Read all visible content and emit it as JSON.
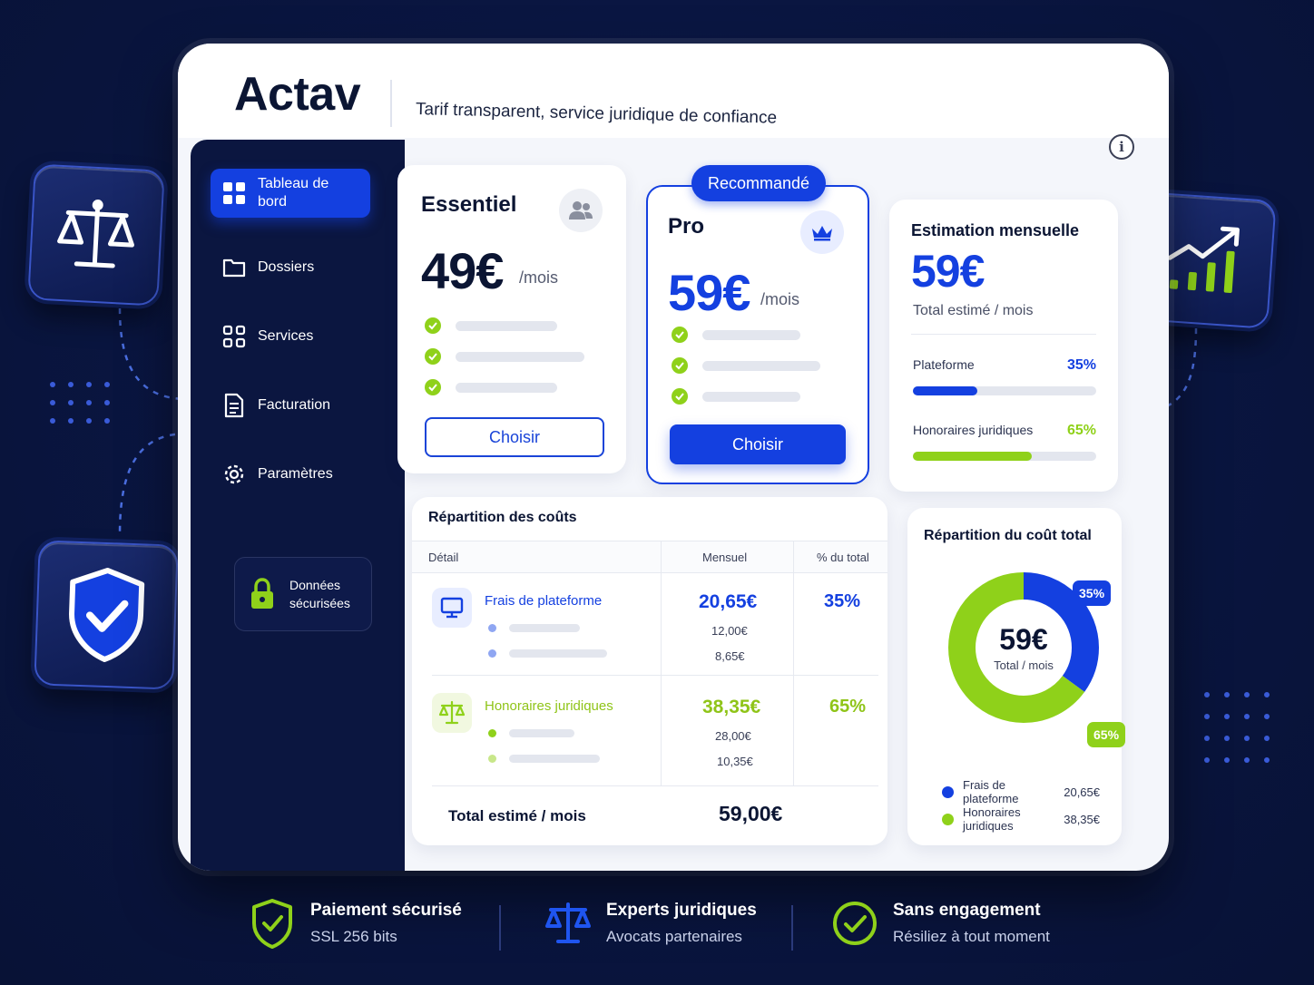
{
  "app": {
    "name": "Actav",
    "tagline": "Tarif transparent, service juridique de confiance"
  },
  "colors": {
    "brand_blue": "#1440e0",
    "accent_green": "#8fd11a",
    "sidebar_bg": "#0b1640",
    "page_bg": "#0a1642"
  },
  "sidebar": {
    "items": [
      {
        "label": "Tableau de bord",
        "icon": "dashboard-icon",
        "active": true
      },
      {
        "label": "Dossiers",
        "icon": "folder-icon",
        "active": false
      },
      {
        "label": "Services",
        "icon": "grid-icon",
        "active": false
      },
      {
        "label": "Facturation",
        "icon": "document-icon",
        "active": false
      },
      {
        "label": "Paramètres",
        "icon": "gear-icon",
        "active": false
      }
    ],
    "secure_label": "Données sécurisées"
  },
  "plans": [
    {
      "name": "Essentiel",
      "price": "49€",
      "unit": "/mois",
      "button": "Choisir",
      "icon": "users-icon",
      "features_count": 3
    },
    {
      "name": "Pro",
      "price": "59€",
      "unit": "/mois",
      "button": "Choisir",
      "icon": "crown-icon",
      "badge": "Recommandé",
      "features_count": 3
    }
  ],
  "estimate": {
    "title": "Estimation mensuelle",
    "amount": "59€",
    "subtitle": "Total estimé / mois",
    "rows": [
      {
        "label": "Plateforme",
        "pct": "35%",
        "value": 0.35,
        "color": "#1440e0"
      },
      {
        "label": "Honoraires juridiques",
        "pct": "65%",
        "value": 0.65,
        "color": "#8fd11a"
      }
    ]
  },
  "breakdown": {
    "title": "Répartition des coûts",
    "headers": {
      "detail": "Détail",
      "monthly": "Mensuel",
      "share": "% du total"
    },
    "rows": [
      {
        "name": "Frais de plateforme",
        "icon": "monitor-icon",
        "amount": "20,65€",
        "sub_amounts": [
          "12,00€",
          "8,65€"
        ],
        "share": "35%",
        "color": "#1440e0"
      },
      {
        "name": "Honoraires juridiques",
        "icon": "scale-icon",
        "amount": "38,35€",
        "sub_amounts": [
          "28,00€",
          "10,35€"
        ],
        "share": "65%",
        "color": "#8fd11a"
      }
    ],
    "total_label": "Total estimé / mois",
    "total_value": "59,00€"
  },
  "chart_data": {
    "type": "pie",
    "title": "Répartition du coût total",
    "center_value": "59€",
    "center_label": "Total / mois",
    "categories": [
      "Frais de plateforme",
      "Honoraires juridiques"
    ],
    "values": [
      35,
      65
    ],
    "value_labels": [
      "35%",
      "65%"
    ],
    "amounts": [
      "20,65€",
      "38,35€"
    ],
    "colors": [
      "#1440e0",
      "#8fd11a"
    ],
    "legend_position": "bottom"
  },
  "footer": {
    "items": [
      {
        "title": "Paiement sécurisé",
        "subtitle": "SSL 256 bits",
        "icon": "shield-check-icon"
      },
      {
        "title": "Experts juridiques",
        "subtitle": "Avocats partenaires",
        "icon": "scale-icon"
      },
      {
        "title": "Sans engagement",
        "subtitle": "Résiliez à tout moment",
        "icon": "check-circle-icon"
      }
    ]
  }
}
